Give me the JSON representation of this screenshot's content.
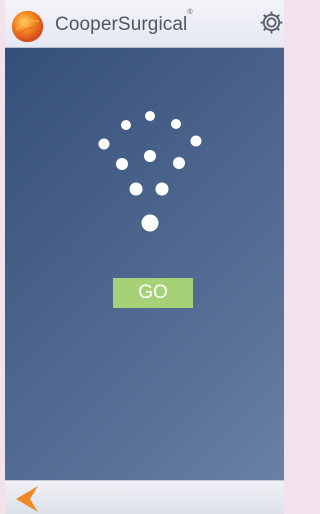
{
  "header": {
    "brand": "CooperSurgical",
    "brand_mark": "®",
    "logo_icon": "orange-sphere-logo",
    "settings_icon": "gear-icon"
  },
  "main": {
    "graphic_icon": "dots-pattern-icon",
    "go_label": "GO",
    "go_color": "#a7d177"
  },
  "footer": {
    "back_icon": "back-arrow-icon",
    "back_color": "#f08a24"
  }
}
